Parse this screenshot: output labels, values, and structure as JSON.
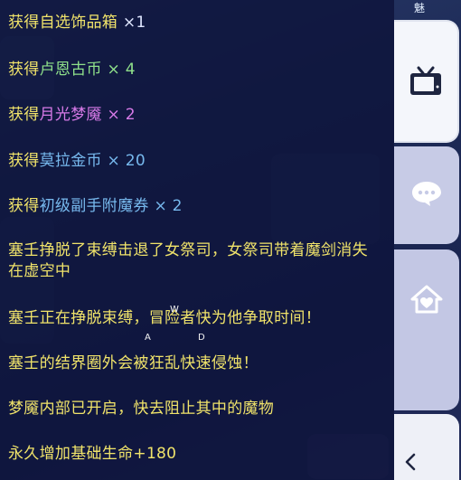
{
  "messages": [
    {
      "prefix": "获得",
      "item": "自选饰品箱",
      "quantity": "×1",
      "item_color": "#f0e36a"
    },
    {
      "prefix": "获得",
      "item": "卢恩古币",
      "quantity": "× 4",
      "item_color": "#8fe08a"
    },
    {
      "prefix": "获得",
      "item": "月光梦魇",
      "quantity": "× 2",
      "item_color": "#d77ae8"
    },
    {
      "prefix": "获得",
      "item": "莫拉金币",
      "quantity": "× 20",
      "item_color": "#77b9ee"
    },
    {
      "prefix": "获得",
      "item": "初级副手附魔券",
      "quantity": "× 2",
      "item_color": "#77b9ee"
    },
    {
      "text": "塞壬挣脱了束缚击退了女祭司，女祭司带着魔剑消失在虚空中"
    },
    {
      "text": "塞壬正在挣脱束缚，冒险者快为他争取时间！"
    },
    {
      "text": "塞壬的结界圈外会被狂乱快速侵蚀！"
    },
    {
      "text": "梦魇内部已开启，快去阻止其中的魔物"
    },
    {
      "text": "永久增加基础生命+180"
    }
  ],
  "overlay_letters": {
    "w": "W",
    "a": "A",
    "d": "D"
  },
  "side_tabs": {
    "top_label": "魅",
    "tv_icon": "tv-icon",
    "chat_icon": "chat-bubble-icon",
    "home_icon": "home-heart-icon",
    "collapse_icon": "chevron-left-icon"
  },
  "colors": {
    "system_text": "#f0e36a",
    "green_item": "#8fe08a",
    "purple_item": "#d77ae8",
    "blue_item": "#77b9ee"
  }
}
